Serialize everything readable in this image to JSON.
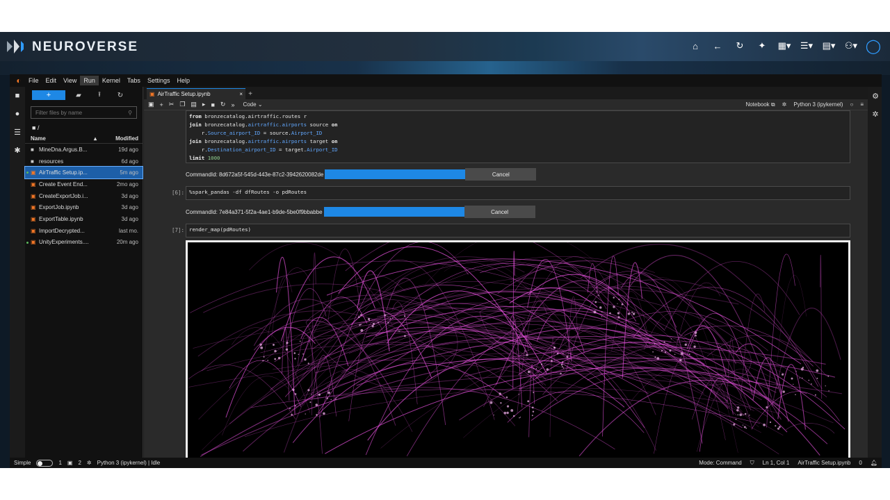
{
  "brand": {
    "name": "NEUROVERSE"
  },
  "top_actions": [
    {
      "icon": "home-icon",
      "glyph": "⌂"
    },
    {
      "icon": "back-icon",
      "glyph": "←"
    },
    {
      "icon": "refresh-icon",
      "glyph": "↻"
    },
    {
      "icon": "share-icon",
      "glyph": "✦"
    },
    {
      "icon": "apps-icon",
      "glyph": "▦▾"
    },
    {
      "icon": "database-icon",
      "glyph": "☰▾"
    },
    {
      "icon": "chat-icon",
      "glyph": "▤▾"
    },
    {
      "icon": "users-settings-icon",
      "glyph": "⚇▾"
    },
    {
      "icon": "user-icon",
      "glyph": "◯"
    }
  ],
  "menu": [
    "File",
    "Edit",
    "View",
    "Run",
    "Kernel",
    "Tabs",
    "Settings",
    "Help"
  ],
  "menu_active": "Run",
  "filebrowser": {
    "new_label": "+",
    "search_placeholder": "Filter files by name",
    "path": "/",
    "col_name": "Name",
    "col_modified": "Modified",
    "files": [
      {
        "name": "MineDna.Argus.B...",
        "modified": "19d ago",
        "type": "folder",
        "selected": false,
        "running": false
      },
      {
        "name": "resources",
        "modified": "6d ago",
        "type": "folder",
        "selected": false,
        "running": false
      },
      {
        "name": "AirTraffic Setup.ip...",
        "modified": "5m ago",
        "type": "notebook",
        "selected": true,
        "running": true
      },
      {
        "name": "Create Event End...",
        "modified": "2mo ago",
        "type": "notebook",
        "selected": false,
        "running": false
      },
      {
        "name": "CreateExportJob.i...",
        "modified": "3d ago",
        "type": "notebook",
        "selected": false,
        "running": false
      },
      {
        "name": "ExportJob.ipynb",
        "modified": "3d ago",
        "type": "notebook",
        "selected": false,
        "running": false
      },
      {
        "name": "ExportTable.ipynb",
        "modified": "3d ago",
        "type": "notebook",
        "selected": false,
        "running": false
      },
      {
        "name": "ImportDecrypted...",
        "modified": "last mo.",
        "type": "notebook",
        "selected": false,
        "running": false
      },
      {
        "name": "UnityExperiments....",
        "modified": "20m ago",
        "type": "notebook",
        "selected": false,
        "running": true
      }
    ]
  },
  "tab": {
    "label": "AirTraffic Setup.ipynb",
    "close": "×",
    "add": "+"
  },
  "nb_toolbar": {
    "cell_type": "Code",
    "notebook_label": "Notebook ⧉",
    "kernel_label": "Python 3 (ipykernel)"
  },
  "cells": {
    "code1": [
      [
        {
          "t": "from ",
          "c": "kw"
        },
        {
          "t": "bronzecatalog.airtraffic.routes r",
          "c": ""
        }
      ],
      [
        {
          "t": "join ",
          "c": "kw"
        },
        {
          "t": "bronzecatalog.",
          "c": ""
        },
        {
          "t": "airtraffic.airports",
          "c": "tbl"
        },
        {
          "t": " source ",
          "c": ""
        },
        {
          "t": "on",
          "c": "kw"
        }
      ],
      [
        {
          "t": "    r.",
          "c": ""
        },
        {
          "t": "Source_airport_ID",
          "c": "tbl"
        },
        {
          "t": " = source.",
          "c": ""
        },
        {
          "t": "Airport_ID",
          "c": "tbl"
        }
      ],
      [
        {
          "t": "join ",
          "c": "kw"
        },
        {
          "t": "bronzecatalog.",
          "c": ""
        },
        {
          "t": "airtraffic.airports",
          "c": "tbl"
        },
        {
          "t": " target ",
          "c": ""
        },
        {
          "t": "on",
          "c": "kw"
        }
      ],
      [
        {
          "t": "    r.",
          "c": ""
        },
        {
          "t": "Destination_airport_ID",
          "c": "tbl"
        },
        {
          "t": " = target.",
          "c": ""
        },
        {
          "t": "Airport_ID",
          "c": "tbl"
        }
      ],
      [
        {
          "t": "limit ",
          "c": "kw"
        },
        {
          "t": "1000",
          "c": "num"
        }
      ]
    ],
    "cmd1": "CommandId: 8d672a5f-545d-443e-87c2-3942620082de",
    "cancel": "Cancel",
    "prompt6": "[6]:",
    "code6": "%spark_pandas -df dfRoutes -o pdRoutes",
    "cmd2": "CommandId: 7e84a371-5f2a-4ae1-b9de-5be0f9bbabbe",
    "prompt7": "[7]:",
    "code7": "render_map(pdRoutes)"
  },
  "status": {
    "mode_simple": "Simple",
    "terminals": "1",
    "kernels": "2",
    "kernel_status": "Python 3 (ipykernel) | Idle",
    "mode": "Mode: Command",
    "position": "Ln 1, Col 1",
    "file": "AirTraffic Setup.ipynb",
    "count": "0"
  },
  "colors": {
    "accent": "#1e88e5",
    "route_pink": "#e04fd8",
    "notebook_orange": "#f37726"
  }
}
